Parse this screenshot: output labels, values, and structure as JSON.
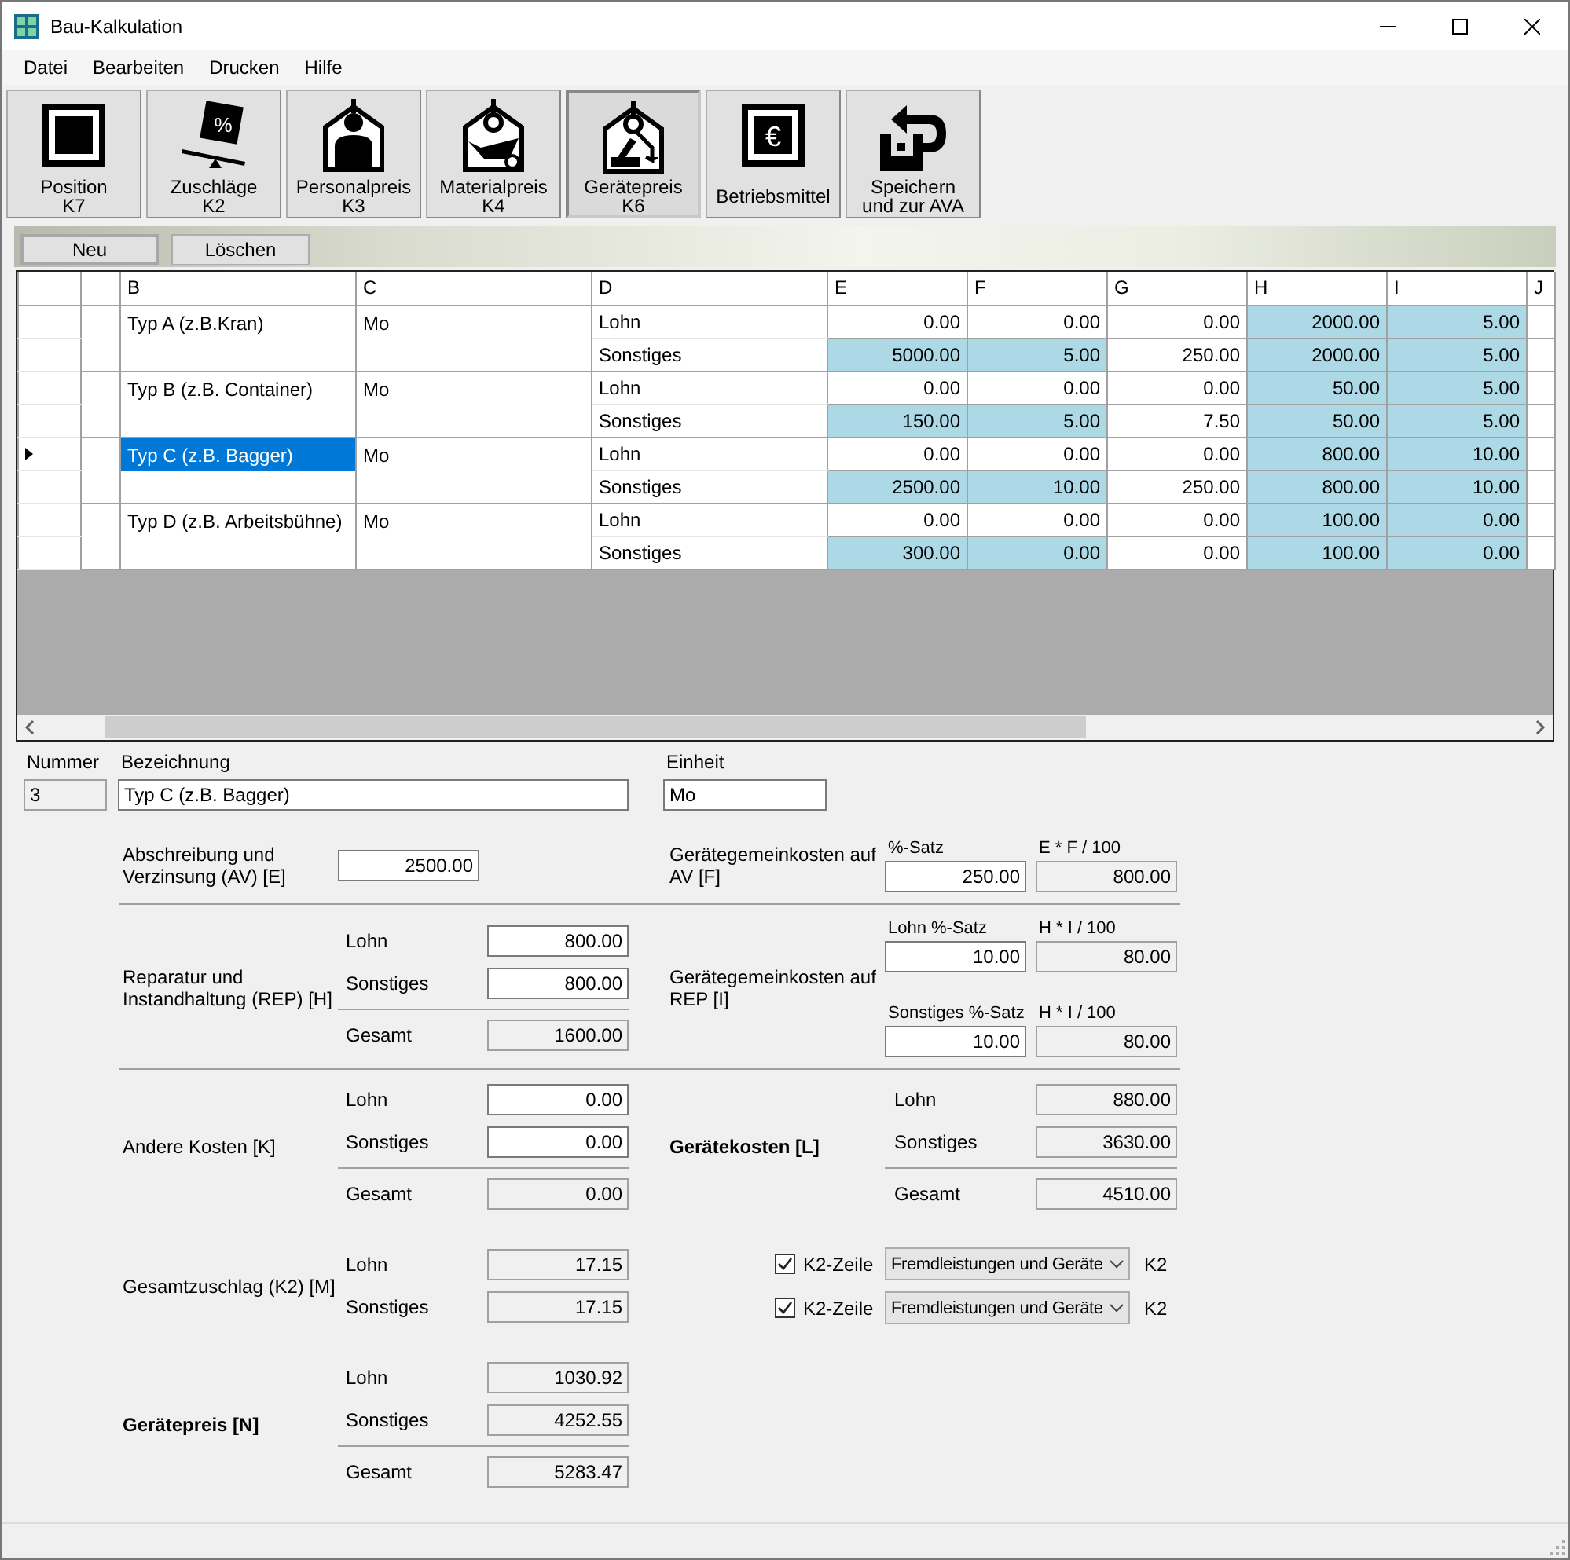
{
  "window": {
    "title": "Bau-Kalkulation"
  },
  "menu": [
    {
      "label": "Datei"
    },
    {
      "label": "Bearbeiten"
    },
    {
      "label": "Drucken"
    },
    {
      "label": "Hilfe"
    }
  ],
  "toolbar": [
    {
      "kind": "position",
      "lines": [
        "Position",
        "K7"
      ],
      "selected": false
    },
    {
      "kind": "surcharge",
      "lines": [
        "Zuschläge",
        "K2"
      ],
      "symbol": "%",
      "selected": false
    },
    {
      "kind": "personnel",
      "lines": [
        "Personalpreis",
        "K3"
      ],
      "selected": false
    },
    {
      "kind": "material",
      "lines": [
        "Materialpreis",
        "K4"
      ],
      "selected": false
    },
    {
      "kind": "equipment",
      "lines": [
        "Gerätepreis",
        "K6"
      ],
      "selected": true
    },
    {
      "kind": "resources",
      "lines": [
        "Betriebsmittel"
      ],
      "symbol": "€",
      "selected": false
    },
    {
      "kind": "save",
      "lines": [
        "Speichern",
        "und zur AVA"
      ],
      "selected": false
    }
  ],
  "actions": [
    {
      "label": "Neu"
    },
    {
      "label": "Löschen"
    }
  ],
  "grid": {
    "columns": [
      "B",
      "C",
      "D",
      "E",
      "F",
      "G",
      "H",
      "I",
      "J"
    ],
    "items": [
      {
        "name": "Typ A (z.B.Kran)",
        "unit": "Mo",
        "selected": false,
        "rows": [
          {
            "label": "Lohn",
            "cells": [
              {
                "value": "0.00",
                "highlighted": false
              },
              {
                "value": "0.00",
                "highlighted": false
              },
              {
                "value": "0.00",
                "highlighted": false
              },
              {
                "value": "2000.00",
                "highlighted": true
              },
              {
                "value": "5.00",
                "highlighted": true
              }
            ]
          },
          {
            "label": "Sonstiges",
            "cells": [
              {
                "value": "5000.00",
                "highlighted": true
              },
              {
                "value": "5.00",
                "highlighted": true
              },
              {
                "value": "250.00",
                "highlighted": false
              },
              {
                "value": "2000.00",
                "highlighted": true
              },
              {
                "value": "5.00",
                "highlighted": true
              }
            ]
          }
        ]
      },
      {
        "name": "Typ B (z.B. Container)",
        "unit": "Mo",
        "selected": false,
        "rows": [
          {
            "label": "Lohn",
            "cells": [
              {
                "value": "0.00",
                "highlighted": false
              },
              {
                "value": "0.00",
                "highlighted": false
              },
              {
                "value": "0.00",
                "highlighted": false
              },
              {
                "value": "50.00",
                "highlighted": true
              },
              {
                "value": "5.00",
                "highlighted": true
              }
            ]
          },
          {
            "label": "Sonstiges",
            "cells": [
              {
                "value": "150.00",
                "highlighted": true
              },
              {
                "value": "5.00",
                "highlighted": true
              },
              {
                "value": "7.50",
                "highlighted": false
              },
              {
                "value": "50.00",
                "highlighted": true
              },
              {
                "value": "5.00",
                "highlighted": true
              }
            ]
          }
        ]
      },
      {
        "name": "Typ C (z.B. Bagger)",
        "unit": "Mo",
        "selected": true,
        "rows": [
          {
            "label": "Lohn",
            "cells": [
              {
                "value": "0.00",
                "highlighted": false
              },
              {
                "value": "0.00",
                "highlighted": false
              },
              {
                "value": "0.00",
                "highlighted": false
              },
              {
                "value": "800.00",
                "highlighted": true
              },
              {
                "value": "10.00",
                "highlighted": true
              }
            ]
          },
          {
            "label": "Sonstiges",
            "cells": [
              {
                "value": "2500.00",
                "highlighted": true
              },
              {
                "value": "10.00",
                "highlighted": true
              },
              {
                "value": "250.00",
                "highlighted": false
              },
              {
                "value": "800.00",
                "highlighted": true
              },
              {
                "value": "10.00",
                "highlighted": true
              }
            ]
          }
        ]
      },
      {
        "name": "Typ D (z.B. Arbeitsbühne)",
        "unit": "Mo",
        "selected": false,
        "rows": [
          {
            "label": "Lohn",
            "cells": [
              {
                "value": "0.00",
                "highlighted": false
              },
              {
                "value": "0.00",
                "highlighted": false
              },
              {
                "value": "0.00",
                "highlighted": false
              },
              {
                "value": "100.00",
                "highlighted": true
              },
              {
                "value": "0.00",
                "highlighted": true
              }
            ]
          },
          {
            "label": "Sonstiges",
            "cells": [
              {
                "value": "300.00",
                "highlighted": true
              },
              {
                "value": "0.00",
                "highlighted": true
              },
              {
                "value": "0.00",
                "highlighted": false
              },
              {
                "value": "100.00",
                "highlighted": true
              },
              {
                "value": "0.00",
                "highlighted": true
              }
            ]
          }
        ]
      }
    ]
  },
  "form": {
    "header": [
      {
        "label": "Nummer",
        "value": "3",
        "readonly": true
      },
      {
        "label": "Bezeichnung",
        "value": "Typ C (z.B. Bagger)",
        "readonly": false
      },
      {
        "label": "Einheit",
        "value": "Mo",
        "readonly": false
      }
    ],
    "sections": [
      {
        "divider": true,
        "left": {
          "kind": "single",
          "label": "Abschreibung und Verzinsung (AV) [E]",
          "emphasis": false,
          "field": {
            "value": "2500.00",
            "readonly": false
          }
        },
        "right": {
          "kind": "pairs",
          "label": "Gerätegemeinkosten auf AV [F]",
          "emphasis": false,
          "pairs": [
            {
              "input_label": "%-Satz",
              "input": {
                "value": "250.00",
                "readonly": false
              },
              "result_label": "E * F / 100",
              "result": {
                "value": "800.00",
                "readonly": true
              }
            }
          ]
        }
      },
      {
        "divider": true,
        "left": {
          "kind": "rows",
          "label": "Reparatur und Instandhaltung (REP) [H]",
          "emphasis": false,
          "rows": [
            {
              "label": "Lohn",
              "value": "800.00",
              "readonly": false
            },
            {
              "label": "Sonstiges",
              "value": "800.00",
              "readonly": false
            }
          ],
          "total": {
            "label": "Gesamt",
            "value": "1600.00",
            "readonly": true
          }
        },
        "right": {
          "kind": "pairs",
          "label": "Gerätegemeinkosten auf REP [I]",
          "emphasis": false,
          "pairs": [
            {
              "input_label": "Lohn %-Satz",
              "input": {
                "value": "10.00",
                "readonly": false
              },
              "result_label": "H * I / 100",
              "result": {
                "value": "80.00",
                "readonly": true
              }
            },
            {
              "input_label": "Sonstiges %-Satz",
              "input": {
                "value": "10.00",
                "readonly": false
              },
              "result_label": "H * I / 100",
              "result": {
                "value": "80.00",
                "readonly": true
              }
            }
          ]
        }
      },
      {
        "divider": false,
        "left": {
          "kind": "rows",
          "label": "Andere Kosten [K]",
          "emphasis": false,
          "rows": [
            {
              "label": "Lohn",
              "value": "0.00",
              "readonly": false
            },
            {
              "label": "Sonstiges",
              "value": "0.00",
              "readonly": false
            }
          ],
          "total": {
            "label": "Gesamt",
            "value": "0.00",
            "readonly": true
          }
        },
        "right": {
          "kind": "rows",
          "label": "Gerätekosten [L]",
          "emphasis": true,
          "rows": [
            {
              "label": "Lohn",
              "value": "880.00",
              "readonly": true
            },
            {
              "label": "Sonstiges",
              "value": "3630.00",
              "readonly": true
            }
          ],
          "total": {
            "label": "Gesamt",
            "value": "4510.00",
            "readonly": true
          }
        }
      },
      {
        "divider": false,
        "left": {
          "kind": "rows",
          "label": "Gesamtzuschlag (K2) [M]",
          "emphasis": false,
          "rows": [
            {
              "label": "Lohn",
              "value": "17.15",
              "readonly": true
            },
            {
              "label": "Sonstiges",
              "value": "17.15",
              "readonly": true
            }
          ]
        },
        "right": {
          "kind": "k2",
          "lines": [
            {
              "checked": true,
              "label": "K2-Zeile",
              "option": "Fremdleistungen und Geräte",
              "suffix": "K2"
            },
            {
              "checked": true,
              "label": "K2-Zeile",
              "option": "Fremdleistungen und Geräte",
              "suffix": "K2"
            }
          ]
        }
      },
      {
        "divider": false,
        "left": {
          "kind": "rows",
          "label": "Gerätepreis [N]",
          "emphasis": true,
          "rows": [
            {
              "label": "Lohn",
              "value": "1030.92",
              "readonly": true
            },
            {
              "label": "Sonstiges",
              "value": "4252.55",
              "readonly": true
            }
          ],
          "total": {
            "label": "Gesamt",
            "value": "5283.47",
            "readonly": true
          }
        }
      }
    ]
  }
}
